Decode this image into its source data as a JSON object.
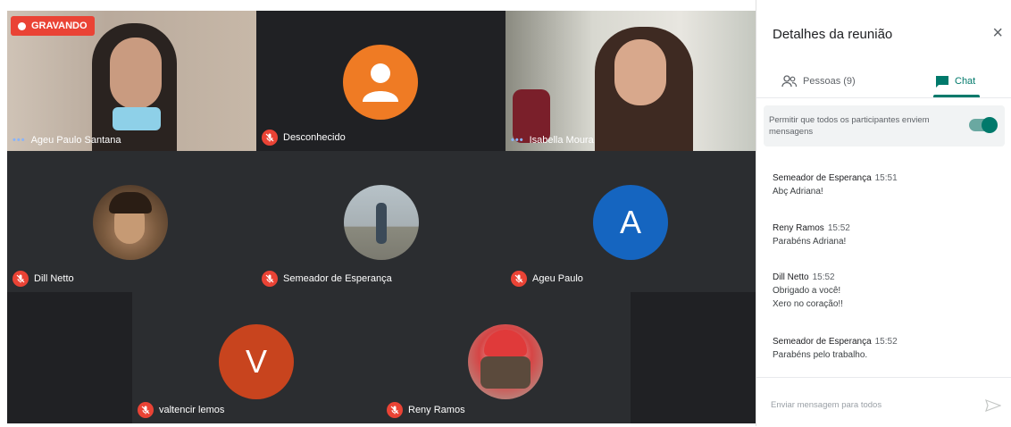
{
  "recording": {
    "label": "GRAVANDO"
  },
  "participants": [
    {
      "name": "Ageu Paulo Santana"
    },
    {
      "name": "Desconhecido"
    },
    {
      "name": "Isabella Moura"
    },
    {
      "name": "Dill Netto"
    },
    {
      "name": "Semeador de Esperança"
    },
    {
      "name": "Ageu Paulo",
      "initial": "A"
    },
    {
      "name": "valtencir lemos",
      "initial": "V"
    },
    {
      "name": "Reny Ramos"
    }
  ],
  "panel": {
    "title": "Detalhes da reunião",
    "close": "×",
    "tabs": [
      {
        "label": "Pessoas (9)"
      },
      {
        "label": "Chat"
      }
    ],
    "permit_text": "Permitir que todos os participantes enviem mensagens",
    "messages": [
      {
        "sender": "Semeador de Esperança",
        "time": "15:51",
        "lines": [
          "Abç Adriana!"
        ]
      },
      {
        "sender": "Reny Ramos",
        "time": "15:52",
        "lines": [
          "Parabéns Adriana!"
        ]
      },
      {
        "sender": "Dill Netto",
        "time": "15:52",
        "lines": [
          "Obrigado a você!",
          "Xero no coração!!"
        ]
      },
      {
        "sender": "Semeador de Esperança",
        "time": "15:52",
        "lines": [
          "Parabéns pelo trabalho."
        ]
      }
    ],
    "input_placeholder": "Enviar mensagem para todos"
  },
  "colors": {
    "accent": "#00796b",
    "mic_off": "#ea4335",
    "avatar_a": "#1565c0",
    "avatar_v": "#c8441e",
    "avatar_unknown": "#ef7b24"
  }
}
